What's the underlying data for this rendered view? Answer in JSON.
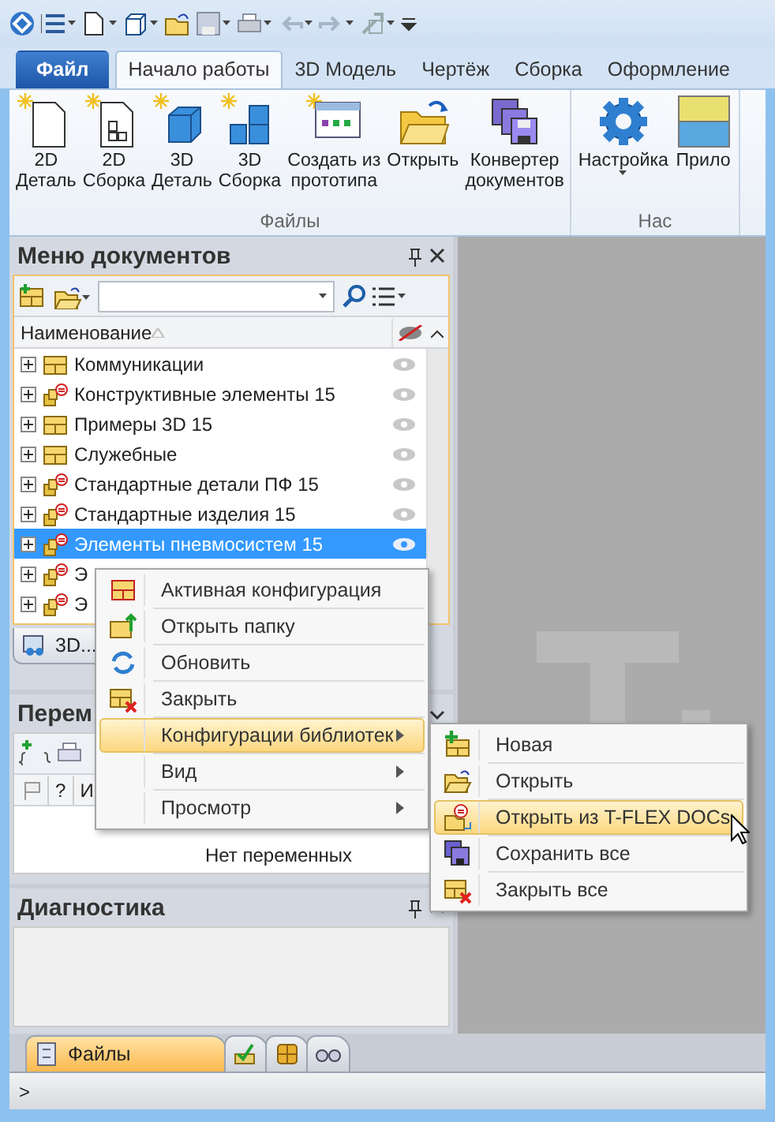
{
  "ribbon": {
    "tabs": [
      {
        "label": "Файл",
        "kind": "file",
        "selected": false
      },
      {
        "label": "Начало работы",
        "kind": "tab",
        "selected": true
      },
      {
        "label": "3D Модель",
        "kind": "tab",
        "selected": false
      },
      {
        "label": "Чертёж",
        "kind": "tab",
        "selected": false
      },
      {
        "label": "Сборка",
        "kind": "tab",
        "selected": false
      },
      {
        "label": "Оформление",
        "kind": "tab",
        "selected": false
      }
    ],
    "groups": [
      {
        "label": "Файлы",
        "buttons": [
          {
            "label": "2D Деталь",
            "kind": "page",
            "dropdown": false
          },
          {
            "label": "2D Сборка",
            "kind": "page-assembly",
            "dropdown": false
          },
          {
            "label": "3D Деталь",
            "kind": "cube",
            "dropdown": false
          },
          {
            "label": "3D Сборка",
            "kind": "cubes",
            "dropdown": false
          },
          {
            "label": "Создать из прототипа",
            "kind": "window",
            "dropdown": false
          },
          {
            "label": "Открыть",
            "kind": "folder",
            "dropdown": false
          },
          {
            "label": "Конвертер документов",
            "kind": "disks",
            "dropdown": false
          }
        ]
      },
      {
        "label": "Нас",
        "buttons": [
          {
            "label": "Настройка",
            "kind": "gear",
            "dropdown": true
          },
          {
            "label": "Прило",
            "kind": "blocks",
            "dropdown": false
          }
        ]
      }
    ]
  },
  "documents_panel": {
    "title": "Меню документов",
    "column": "Наименование",
    "bottom_tab": "3D...",
    "rows": [
      {
        "label": "Коммуникации",
        "kind": "folder",
        "selected": false
      },
      {
        "label": "Конструктивные элементы 15",
        "kind": "library",
        "selected": false
      },
      {
        "label": "Примеры 3D 15",
        "kind": "folder",
        "selected": false
      },
      {
        "label": "Служебные",
        "kind": "folder",
        "selected": false
      },
      {
        "label": "Стандартные детали ПФ 15",
        "kind": "library",
        "selected": false
      },
      {
        "label": "Стандартные изделия 15",
        "kind": "library",
        "selected": false
      },
      {
        "label": "Элементы пневмосистем 15",
        "kind": "library",
        "selected": true
      },
      {
        "label": "Э",
        "kind": "library",
        "selected": false
      },
      {
        "label": "Э",
        "kind": "library",
        "selected": false
      }
    ]
  },
  "variables_panel": {
    "title": "Перем",
    "columns": [
      "?",
      "И"
    ],
    "empty_text": "Нет переменных"
  },
  "diagnostics_panel": {
    "title": "Диагностика"
  },
  "bottom_tabs": [
    {
      "label": "Файлы",
      "kind": "files",
      "selected": true
    },
    {
      "kind": "check",
      "selected": false
    },
    {
      "kind": "box",
      "selected": false
    },
    {
      "kind": "binoculars",
      "selected": false
    }
  ],
  "command_line": {
    "prompt": ">"
  },
  "context_menu": {
    "items": [
      {
        "label": "Активная конфигурация",
        "kind": "config",
        "submenu": false,
        "selected": false
      },
      {
        "label": "Открыть папку",
        "kind": "folder-up",
        "submenu": false,
        "selected": false
      },
      {
        "label": "Обновить",
        "kind": "refresh",
        "submenu": false,
        "selected": false
      },
      {
        "label": "Закрыть",
        "kind": "close",
        "submenu": false,
        "selected": false
      },
      {
        "label": "Конфигурации библиотек",
        "kind": "none",
        "submenu": true,
        "selected": true
      },
      {
        "label": "Вид",
        "kind": "none",
        "submenu": true,
        "selected": false
      },
      {
        "label": "Просмотр",
        "kind": "none",
        "submenu": true,
        "selected": false
      }
    ]
  },
  "submenu": {
    "items": [
      {
        "label": "Новая",
        "kind": "new",
        "selected": false
      },
      {
        "label": "Открыть",
        "kind": "open",
        "selected": false
      },
      {
        "label": "Открыть из T-FLEX DOCs",
        "kind": "docs",
        "selected": true
      },
      {
        "label": "Сохранить все",
        "kind": "save",
        "selected": false
      },
      {
        "label": "Закрыть все",
        "kind": "close",
        "selected": false
      }
    ]
  }
}
